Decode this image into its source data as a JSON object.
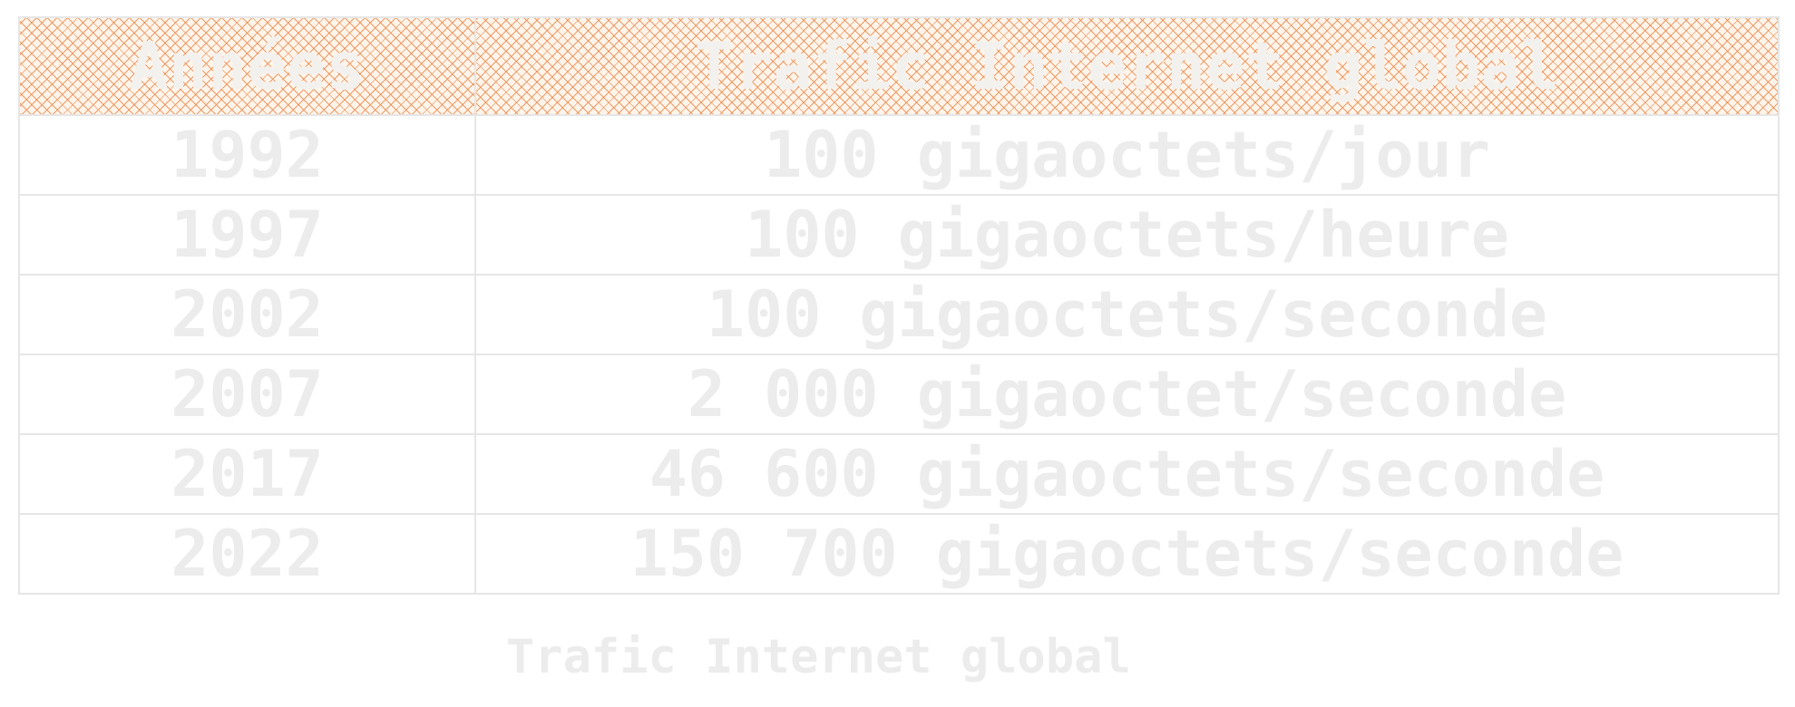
{
  "table": {
    "headers": [
      "Années",
      "Trafic Internet global"
    ],
    "rows": [
      [
        "1992",
        "100 gigaoctets/jour"
      ],
      [
        "1997",
        "100 gigaoctets/heure"
      ],
      [
        "2002",
        "100 gigaoctets/seconde"
      ],
      [
        "2007",
        "2 000 gigaoctet/seconde"
      ],
      [
        "2017",
        "46 600 gigaoctets/seconde"
      ],
      [
        "2022",
        "150 700 gigaoctets/seconde"
      ]
    ]
  },
  "caption": "Trafic Internet global",
  "colors": {
    "header_hatch": "#e98c50",
    "text": "#ececec",
    "border": "#e6e6e6"
  }
}
